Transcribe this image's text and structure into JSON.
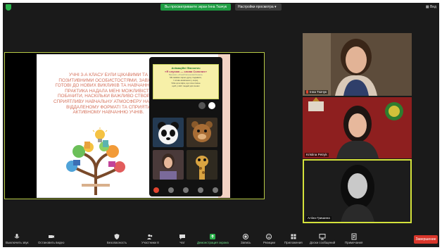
{
  "topbar": {
    "share_notice": "Вы просматриваете экран Інна Ткачук",
    "view_options": "Настройки просмотра",
    "view_button": "Вид"
  },
  "slide": {
    "text": "Учні 3-А класу були цікавими та позитивними особистостями, завжди готові до нових викликів та навчання. Ця практика надала мені можливість побачити, наскільки важливо створити сприятливу навчальну атмосферу навіть у віддаленому форматі та сприяти активному навчанню учнів.",
    "phone_notice": {
      "title_1": "Анімаційні Фанзоточ",
      "title_2": "«Я слухаю — слова Солоних»",
      "subtitle": "Віршики «Усний/письмовий/знаки»",
      "lines": [
        "Ми вміємо гарно душу подавати,",
        "І слово-мовлення у серці,",
        "Усім ця ж віра, що хоче пахне",
        "щоб у світі людей для інших"
      ]
    }
  },
  "participants": [
    {
      "name": "Інна Ткачук",
      "muted": true
    },
    {
      "name": "Kristina Petryk",
      "muted": false
    },
    {
      "name": "Аліна Гришина",
      "muted": false
    }
  ],
  "toolbar": {
    "mute": "Выключить звук",
    "stop_video": "Остановить видео",
    "security": "Безопасность",
    "participants": "Участники",
    "participants_count": "8",
    "chat": "Чат",
    "share": "Демонстрация экрана",
    "record": "Запись",
    "reactions": "Реакции",
    "apps": "Приложения",
    "whiteboards": "Доски сообщений",
    "notes": "Примечания",
    "end": "Завершение"
  },
  "colors": {
    "share_green": "#1f9d43",
    "end_red": "#d9362b",
    "slide_text": "#d4705a",
    "active_speaker": "#d4e23b"
  }
}
